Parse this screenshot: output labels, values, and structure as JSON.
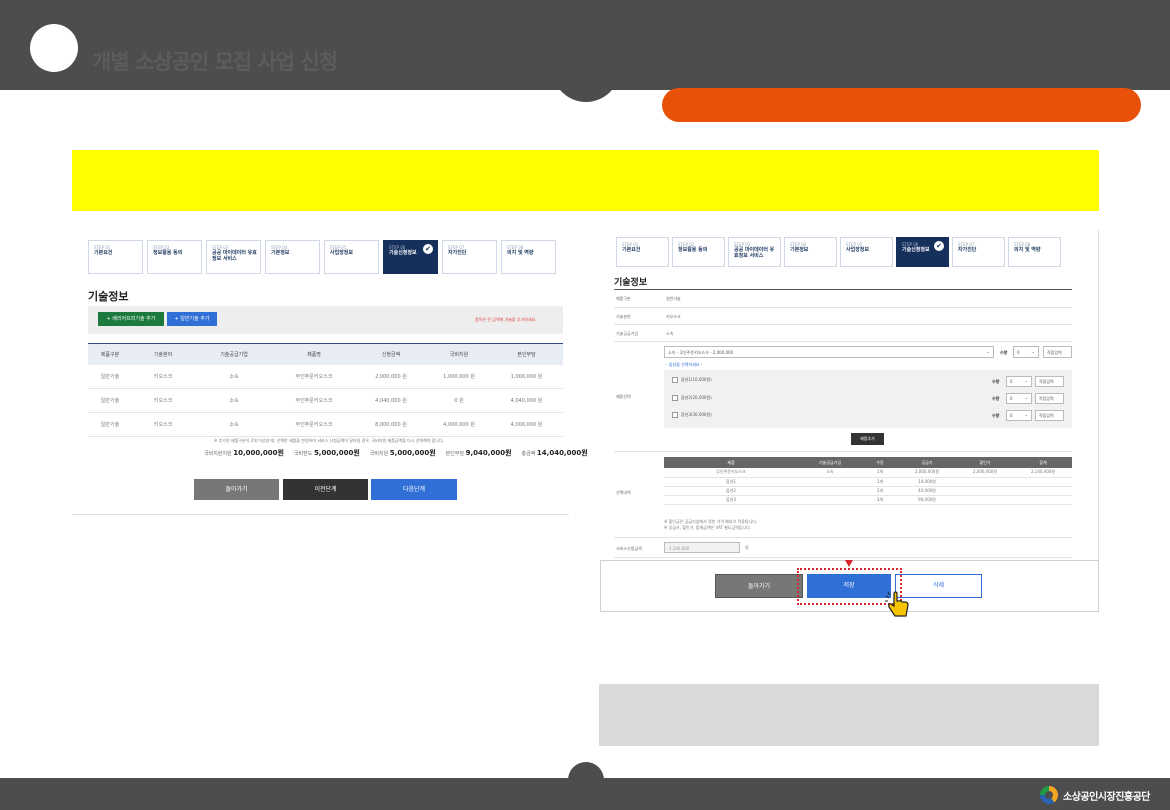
{
  "header": {
    "title": "개별 소상공인 모집 사업 신청"
  },
  "steps": [
    {
      "num": "STEP 01",
      "label": "기본요건"
    },
    {
      "num": "STEP 02",
      "label": "정보활용 동의"
    },
    {
      "num": "STEP 03",
      "label": "공공 마이데이터 유효정보 서비스"
    },
    {
      "num": "STEP 04",
      "label": "기본정보"
    },
    {
      "num": "STEP 05",
      "label": "사업장정보"
    },
    {
      "num": "STEP 06",
      "label": "기술신청정보"
    },
    {
      "num": "STEP 07",
      "label": "자가진단"
    },
    {
      "num": "STEP 08",
      "label": "의지 및 역량"
    }
  ],
  "left": {
    "title": "기술정보",
    "add_premium": "+ 베리어프리기술 추가",
    "add_general": "+ 일반기술 추가",
    "notice": "품목은 전 금액에 기술을 추가하세요.",
    "table": {
      "headers": [
        "제품구분",
        "기술분야",
        "기술공급기업",
        "제품명",
        "신청금액",
        "국비지원",
        "본인부담"
      ],
      "rows": [
        [
          "일반기술",
          "키오스크",
          "소속",
          "무인주문키오스크",
          "2,000,000 원",
          "1,000,000 원",
          "1,000,000 원"
        ],
        [
          "일반기술",
          "키오스크",
          "소속",
          "무인주문키오스크",
          "4,040,000 원",
          "0 원",
          "4,040,000 원"
        ],
        [
          "일반기술",
          "키오스크",
          "소속",
          "무인주문키오스크",
          "8,000,000 원",
          "4,000,000 원",
          "4,000,000 원"
        ]
      ]
    },
    "footnote": "※ 추가된 제품구분이 2개 이상일 때, 선택한 제품을 변경하여 서비스 신청금액이 달라질 경우, 국비지원 제품금액을 다시 선택해야 합니다.",
    "summary": [
      {
        "label": "국비지원지원",
        "value": "10,000,000원"
      },
      {
        "label": "국비한도",
        "value": "5,000,000원"
      },
      {
        "label": "국비지원",
        "value": "5,000,000원"
      },
      {
        "label": "본인부담",
        "value": "9,040,000원"
      },
      {
        "label": "총금액",
        "value": "14,040,000원"
      }
    ],
    "btn_back": "돌아가기",
    "btn_prev": "이전단계",
    "btn_next": "다음단계"
  },
  "right": {
    "title": "기술정보",
    "fields": [
      {
        "label": "제품구분",
        "value": "일반기술"
      },
      {
        "label": "기술분야",
        "value": "키오스크"
      },
      {
        "label": "기술공급기업",
        "value": "소속"
      }
    ],
    "product_label": "제품선택",
    "product_select": "소속 - 무인주문키오스크 - 2,000,000",
    "qty_label": "수량",
    "qty_value": "0",
    "direct_input": "직접입력",
    "option_hint": "- 옵션을 선택하세요 -",
    "options": [
      {
        "name": "옵션1(10,000원)"
      },
      {
        "name": "옵션2(20,000원)"
      },
      {
        "name": "옵션3(30,000원)"
      }
    ],
    "add_product": "제품추가",
    "selected_label": "선택내역",
    "sel_headers": [
      "제품",
      "기술공급기업",
      "수량",
      "공급가",
      "할인가",
      "합계"
    ],
    "sel_rows": [
      [
        "무인주문키오스크",
        "소속",
        "1개",
        "2,000,000원",
        "2,000,000원",
        "2,140,000원"
      ],
      [
        "옵션1",
        "",
        "1개",
        "10,000원",
        "",
        ""
      ],
      [
        "옵션2",
        "",
        "2개",
        "40,000원",
        "",
        ""
      ],
      [
        "옵션3",
        "",
        "3개",
        "90,000원",
        "",
        ""
      ]
    ],
    "sel_note1": "※ 할인금은 공급기업에서 정한 가격 예외가 적용됩니다.",
    "sel_note2": "※ 공급가, 할인가, 합계금액은 VAT 별도금액입니다.",
    "total_label": "서비스신청금액",
    "total_value": "2,140,000",
    "total_unit": "원",
    "btn_back": "돌아가기",
    "btn_save": "저장",
    "btn_delete": "삭제"
  },
  "brand": {
    "org": "소상공인시장진흥공단"
  }
}
